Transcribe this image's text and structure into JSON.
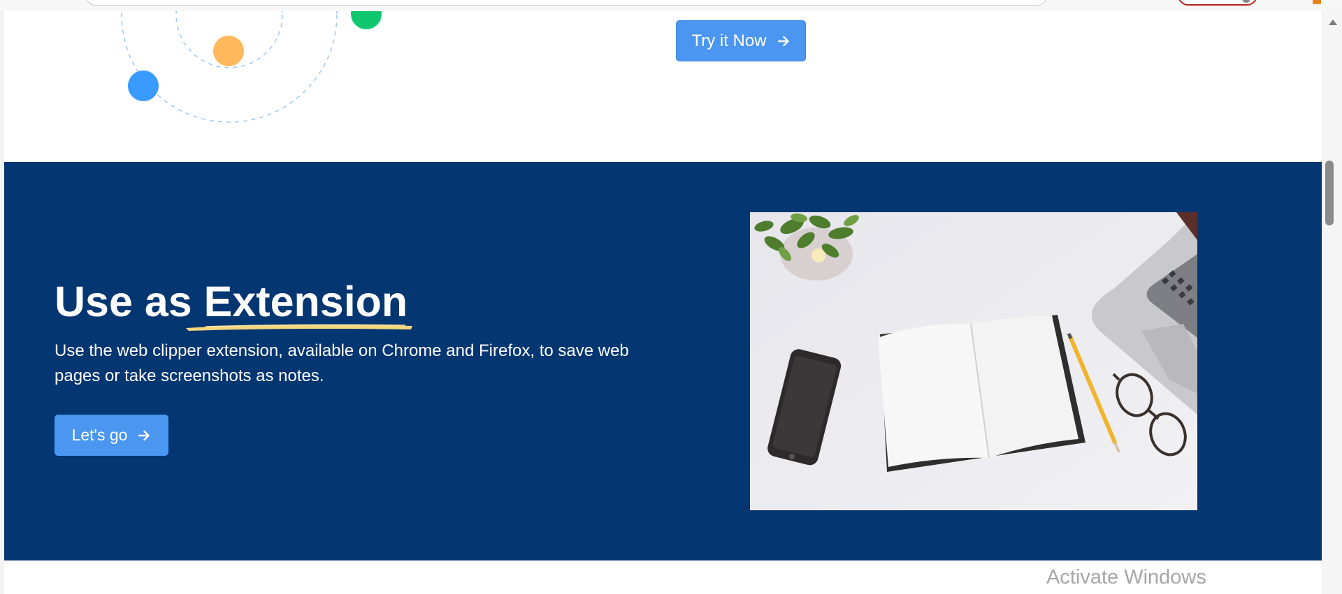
{
  "primary_action": {
    "label": "Try it Now",
    "icon": "arrow-right-icon"
  },
  "extension_section": {
    "title_prefix": "Use as ",
    "title_highlight": "Extension",
    "description": "Use the web clipper extension, available on Chrome and Firefox, to save web pages or take screenshots as notes.",
    "cta_label": "Let's go",
    "cta_icon": "arrow-right-icon",
    "image": "desk-workspace-photo",
    "background_color": "#043672"
  },
  "colors": {
    "accent": "#4a96f0",
    "highlight_stroke": "#f5d77c",
    "orbit_blue": "#3a9bff",
    "orbit_orange": "#ffb95c",
    "orbit_green": "#10c76f"
  },
  "watermark": {
    "text": "Activate Windows"
  }
}
